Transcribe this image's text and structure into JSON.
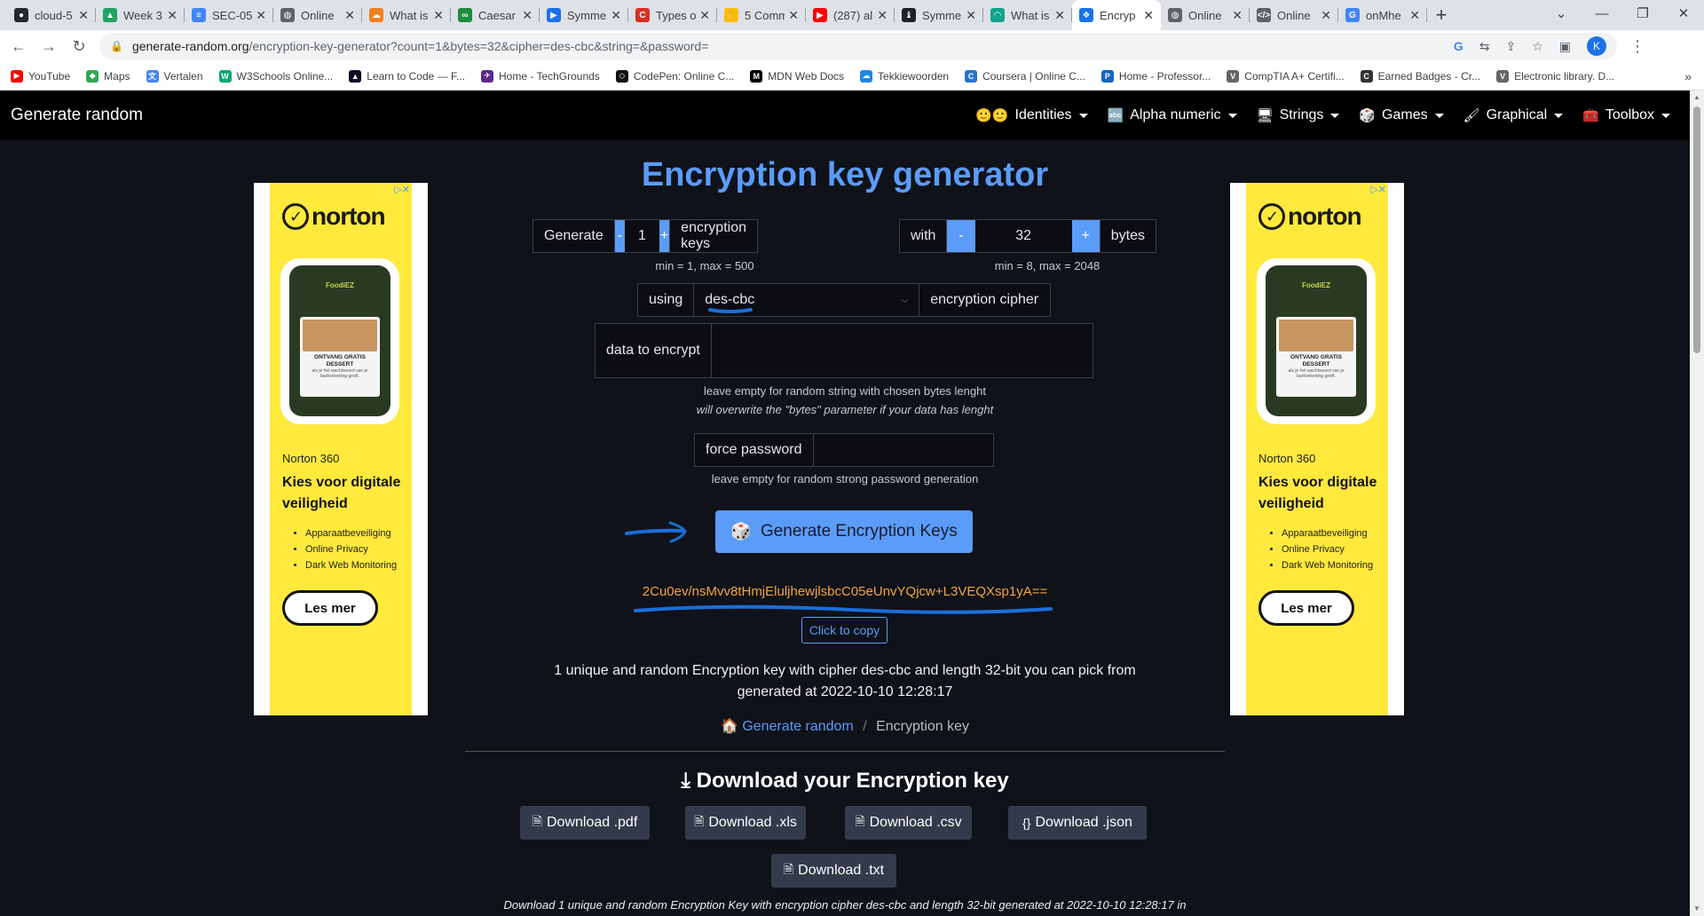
{
  "browser": {
    "tabs": [
      {
        "title": "cloud-5",
        "fav": "#24292f",
        "glyph": "●"
      },
      {
        "title": "Week 3",
        "fav": "#1fa463",
        "glyph": "▲"
      },
      {
        "title": "SEC-05",
        "fav": "#4285f4",
        "glyph": "≡"
      },
      {
        "title": "Online",
        "fav": "#5f6368",
        "glyph": "◍"
      },
      {
        "title": "What is",
        "fav": "#f38020",
        "glyph": "☁"
      },
      {
        "title": "Caesar",
        "fav": "#1e8e3e",
        "glyph": "∞"
      },
      {
        "title": "Symme",
        "fav": "#1a73e8",
        "glyph": "▶"
      },
      {
        "title": "Types o",
        "fav": "#d93025",
        "glyph": "C"
      },
      {
        "title": "5 Comm",
        "fav": "#fbbc04",
        "glyph": "✋"
      },
      {
        "title": "(287) al",
        "fav": "#ff0000",
        "glyph": "▶"
      },
      {
        "title": "Symme",
        "fav": "#202124",
        "glyph": "♝"
      },
      {
        "title": "What is",
        "fav": "#12a38d",
        "glyph": "◠"
      },
      {
        "title": "Encryp",
        "fav": "#1a73e8",
        "glyph": "❖"
      },
      {
        "title": "Online",
        "fav": "#5f6368",
        "glyph": "◍"
      },
      {
        "title": "Online",
        "fav": "#5f6368",
        "glyph": "</>"
      },
      {
        "title": "onMhe",
        "fav": "#4285f4",
        "glyph": "G"
      }
    ],
    "active_tab": 12,
    "new_tab": "+",
    "url_host": "generate-random.org",
    "url_path": "/encryption-key-generator?count=1&bytes=32&cipher=des-cbc&string=&password=",
    "profile_initial": "K",
    "bookmarks": [
      {
        "label": "YouTube",
        "fav": "#ff0000",
        "glyph": "▶"
      },
      {
        "label": "Maps",
        "fav": "#34a853",
        "glyph": "◆"
      },
      {
        "label": "Vertalen",
        "fav": "#4285f4",
        "glyph": "文"
      },
      {
        "label": "W3Schools Online...",
        "fav": "#04aa6d",
        "glyph": "W"
      },
      {
        "label": "Learn to Code — F...",
        "fav": "#0a0a23",
        "glyph": "▲"
      },
      {
        "label": "Home - TechGrounds",
        "fav": "#5b2a86",
        "glyph": "✈"
      },
      {
        "label": "CodePen: Online C...",
        "fav": "#111111",
        "glyph": "◇"
      },
      {
        "label": "MDN Web Docs",
        "fav": "#000000",
        "glyph": "M"
      },
      {
        "label": "Tekkiewoorden",
        "fav": "#1e88e5",
        "glyph": "☁"
      },
      {
        "label": "Coursera | Online C...",
        "fav": "#2a73cc",
        "glyph": "C"
      },
      {
        "label": "Home - Professor...",
        "fav": "#1565c0",
        "glyph": "P"
      },
      {
        "label": "CompTIA A+ Certifi...",
        "fav": "#666666",
        "glyph": "V"
      },
      {
        "label": "Earned Badges - Cr...",
        "fav": "#333333",
        "glyph": "C"
      },
      {
        "label": "Electronic library. D...",
        "fav": "#666666",
        "glyph": "V"
      }
    ],
    "bookmarks_more": "»"
  },
  "site": {
    "brand": "Generate random",
    "menu": [
      {
        "icon": "🙂🙂",
        "label": "Identities"
      },
      {
        "icon": "🔤",
        "label": "Alpha numeric"
      },
      {
        "icon": "🖥",
        "label": "Strings"
      },
      {
        "icon": "🎲",
        "label": "Games"
      },
      {
        "icon": "🖌",
        "label": "Graphical"
      },
      {
        "icon": "🧰",
        "label": "Toolbox"
      }
    ]
  },
  "ad": {
    "close": "▷✕",
    "brand": "norton",
    "app_name": "FoodiEZ",
    "card_title": "ONTVANG GRATIS DESSERT",
    "card_sub": "als je het wachtwoord van je bankrekening geeft.",
    "product": "Norton 360",
    "headline": "Kies voor digitale veiligheid",
    "bullets": [
      "Apparaatbeveiliging",
      "Online Privacy",
      "Dark Web Monitoring"
    ],
    "cta": "Les mer"
  },
  "main": {
    "title": "Encryption key generator",
    "count": {
      "prefix": "Generate",
      "minus": "-",
      "value": "1",
      "plus": "+",
      "suffix": "encryption keys",
      "hint": "min = 1, max = 500"
    },
    "bytes": {
      "prefix": "with",
      "minus": "-",
      "value": "32",
      "plus": "+",
      "suffix": "bytes",
      "hint": "min = 8, max = 2048"
    },
    "cipher": {
      "prefix": "using",
      "value": "des-cbc",
      "suffix": "encryption cipher"
    },
    "data_label": "data to encrypt",
    "data_value": "",
    "data_hint1": "leave empty for random string with chosen bytes lenght",
    "data_hint2": "will overwrite the \"bytes\" parameter if your data has lenght",
    "password_label": "force password",
    "password_value": "",
    "password_hint": "leave empty for random strong password generation",
    "generate_button": "Generate Encryption Keys",
    "result_key": "2Cu0ev/nsMvv8tHmjEluljhewjlsbcC05eUnvYQjcw+L3VEQXsp1yA==",
    "copy_button": "Click to copy",
    "description": "1 unique and random Encryption key with cipher des-cbc and length 32-bit you can pick from generated at 2022-10-10 12:28:17",
    "breadcrumb_home": "Generate random",
    "breadcrumb_sep": "/",
    "breadcrumb_current": "Encryption key",
    "download_title": "Download your Encryption key",
    "downloads": [
      "Download .pdf",
      "Download .xls",
      "Download .csv",
      "Download .json",
      "Download .txt"
    ],
    "footer_text": "Download 1 unique and random Encryption Key with encryption cipher des-cbc and length 32-bit generated at 2022-10-10 12:28:17 in"
  },
  "colors": {
    "accent": "#5a9cf8",
    "key": "#f3a43d",
    "annotation": "#1a6fd8",
    "ad_bg": "#ffe93d"
  }
}
